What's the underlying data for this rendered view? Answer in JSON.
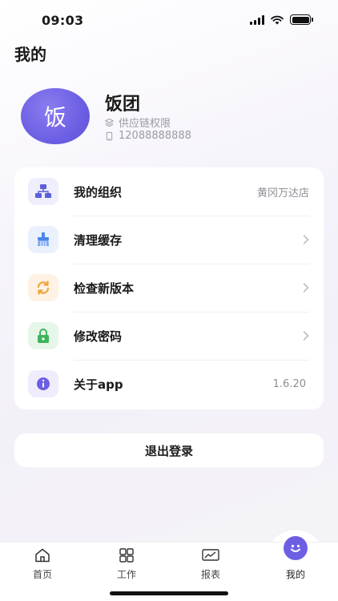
{
  "status_bar": {
    "time": "09:03"
  },
  "page": {
    "title": "我的"
  },
  "profile": {
    "avatar_text": "饭",
    "name": "饭团",
    "role": "供应链权限",
    "phone": "12088888888"
  },
  "menu": {
    "items": [
      {
        "label": "我的组织",
        "value": "黄冈万达店",
        "icon": "organization-icon",
        "color": "#5b5fd8"
      },
      {
        "label": "清理缓存",
        "value": "",
        "icon": "broom-icon",
        "color": "#4a86e8"
      },
      {
        "label": "检查新版本",
        "value": "",
        "icon": "refresh-icon",
        "color": "#f0a43a"
      },
      {
        "label": "修改密码",
        "value": "",
        "icon": "lock-icon",
        "color": "#3db35a"
      },
      {
        "label": "关于app",
        "value": "1.6.20",
        "icon": "info-icon",
        "color": "#6d5fe3"
      }
    ]
  },
  "logout": {
    "label": "退出登录"
  },
  "tab_bar": {
    "items": [
      {
        "label": "首页",
        "icon": "home-icon"
      },
      {
        "label": "工作",
        "icon": "grid-icon"
      },
      {
        "label": "报表",
        "icon": "chart-icon"
      },
      {
        "label": "我的",
        "icon": "smile-icon",
        "active": true
      }
    ]
  },
  "colors": {
    "accent": "#6d5fe3",
    "background": "#f3f1f8"
  }
}
